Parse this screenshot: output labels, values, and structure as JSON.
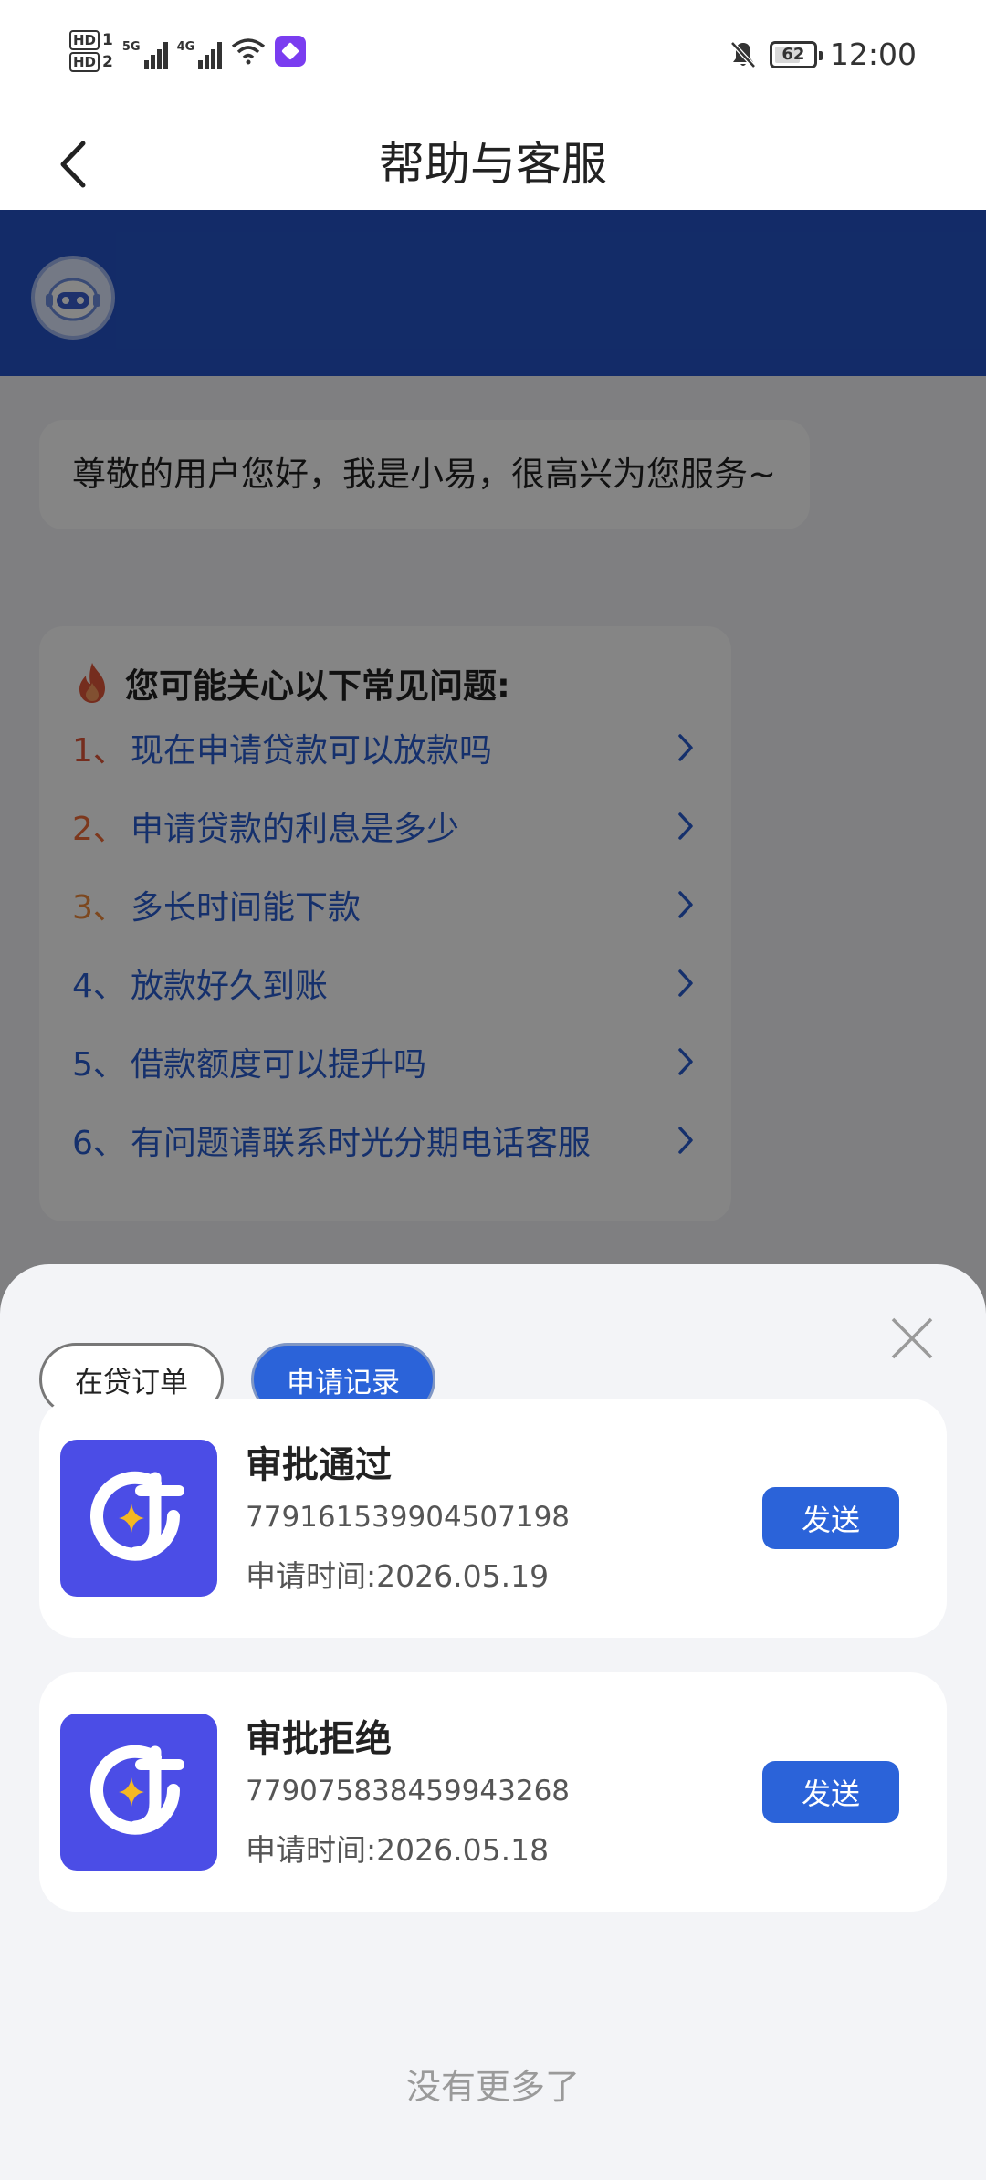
{
  "status_bar": {
    "hd1": "HD",
    "hd1_slot": "1",
    "hd2": "HD",
    "hd2_slot": "2",
    "net1": "5G",
    "net2": "4G",
    "battery": "62",
    "time": "12:00"
  },
  "nav": {
    "title": "帮助与客服"
  },
  "chat": {
    "greeting": "尊敬的用户您好，我是小易，很高兴为您服务~",
    "faq_title": "您可能关心以下常见问题:",
    "faq_items": [
      {
        "num": "1、",
        "text": "现在申请贷款可以放款吗",
        "num_color": "#e0563a"
      },
      {
        "num": "2、",
        "text": "申请贷款的利息是多少",
        "num_color": "#ef6b39"
      },
      {
        "num": "3、",
        "text": "多长时间能下款",
        "num_color": "#ef8a3c"
      },
      {
        "num": "4、",
        "text": "放款好久到账",
        "num_color": "#2a5dcf"
      },
      {
        "num": "5、",
        "text": "借款额度可以提升吗",
        "num_color": "#2a5dcf"
      },
      {
        "num": "6、",
        "text": "有问题请联系时光分期电话客服",
        "num_color": "#2a5dcf"
      }
    ]
  },
  "sheet": {
    "tabs": [
      {
        "label": "在贷订单",
        "active": false
      },
      {
        "label": "申请记录",
        "active": true
      }
    ],
    "records": [
      {
        "status": "审批通过",
        "order_no": "779161539904507198",
        "time": "申请时间:2026.05.19",
        "send_label": "发送"
      },
      {
        "status": "审批拒绝",
        "order_no": "779075838459943268",
        "time": "申请时间:2026.05.18",
        "send_label": "发送"
      }
    ],
    "footer": "没有更多了"
  },
  "colors": {
    "primary": "#2b63d9",
    "banner": "#2554c8",
    "app_logo": "#4b4de6",
    "logo_star": "#f5b822"
  },
  "icons": {
    "back": "chevron-left-icon",
    "close": "close-icon",
    "faq_head": "fire-icon",
    "faq_chevron": "chevron-right-icon",
    "avatar": "robot-avatar-icon",
    "record_logo": "app-logo-icon"
  }
}
